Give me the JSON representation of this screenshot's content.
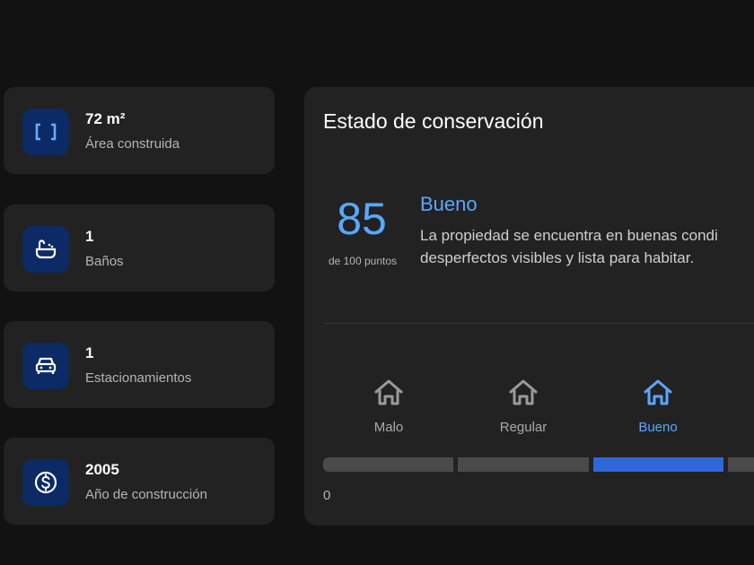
{
  "stats": [
    {
      "value": "72 m²",
      "label": "Área construida",
      "icon": "brackets-icon"
    },
    {
      "value": "1",
      "label": "Baños",
      "icon": "bathtub-icon"
    },
    {
      "value": "1",
      "label": "Estacionamientos",
      "icon": "car-icon"
    },
    {
      "value": "2005",
      "label": "Año de construcción",
      "icon": "dollar-coin-icon"
    }
  ],
  "condition": {
    "title": "Estado de conservación",
    "score": "85",
    "score_sub": "de 100 puntos",
    "rating": "Bueno",
    "description_line1": "La propiedad se encuentra en buenas condi",
    "description_line2": "desperfectos visibles y lista para habitar.",
    "levels": [
      {
        "label": "Malo",
        "active": false
      },
      {
        "label": "Regular",
        "active": false
      },
      {
        "label": "Bueno",
        "active": true
      }
    ],
    "scale_min": "0"
  },
  "colors": {
    "background": "#121212",
    "card": "#222222",
    "accent": "#5aa7ff",
    "active_bar": "#2f66d9",
    "icon_bg": "#0b2a66"
  }
}
